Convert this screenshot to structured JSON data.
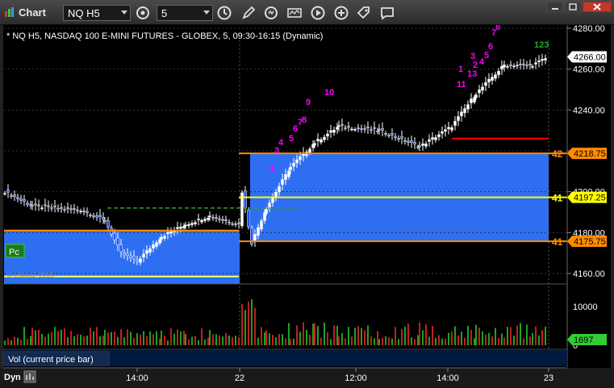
{
  "window": {
    "title": "Chart"
  },
  "toolbar": {
    "symbol": "NQ H5",
    "interval": "5"
  },
  "chart_data": {
    "type": "candlestick",
    "title": "* NQ H5, NASDAQ 100 E-MINI FUTURES - GLOBEX, 5, 09:30-16:15 (Dynamic)",
    "watermark": "© eSignal, 2015",
    "price_axis": {
      "ylim": [
        4155,
        4285
      ],
      "ticks": [
        4160,
        4180,
        4200,
        4220,
        4240,
        4260,
        4280
      ]
    },
    "price_badges": [
      {
        "value": "4266.00",
        "color": "#ffffff"
      },
      {
        "value": "4218.75",
        "color": "#ff8c00"
      },
      {
        "value": "4197.25",
        "color": "#ffff00"
      },
      {
        "value": "4175.75",
        "color": "#ff8c00"
      }
    ],
    "level_labels": [
      {
        "text": "42",
        "value": 4218.75,
        "color": "#ff8c00"
      },
      {
        "text": "41",
        "value": 4197.25,
        "color": "#ffff00"
      },
      {
        "text": "41",
        "value": 4175.75,
        "color": "#ff8c00"
      }
    ],
    "pc_label": "Pc",
    "levels": [
      {
        "value": 4218.75,
        "color": "#ff8c00"
      },
      {
        "value": 4197.25,
        "color": "#ffff00"
      },
      {
        "value": 4175.75,
        "color": "#ff8c00"
      },
      {
        "value": 4181,
        "color": "#ff8c00",
        "session": 1
      },
      {
        "value": 4158.5,
        "color": "#ffff66",
        "session": 1
      },
      {
        "value": 4226,
        "color": "#ff0000",
        "session": 2
      }
    ],
    "td_counts": [
      {
        "text": "1",
        "color": "#ff00ff"
      },
      {
        "text": "3",
        "color": "#ff00ff"
      },
      {
        "text": "4",
        "color": "#ff00ff"
      },
      {
        "text": "5",
        "color": "#ff00ff"
      },
      {
        "text": "6",
        "color": "#ff00ff"
      },
      {
        "text": "7",
        "color": "#ff00ff"
      },
      {
        "text": "8",
        "color": "#ff00ff"
      },
      {
        "text": "9",
        "color": "#ff00ff"
      },
      {
        "text": "10",
        "color": "#ff00ff"
      },
      {
        "text": "1",
        "color": "#ff00ff"
      },
      {
        "text": "11",
        "color": "#ff00ff"
      },
      {
        "text": "13",
        "color": "#ff00ff"
      },
      {
        "text": "2",
        "color": "#ff00ff"
      },
      {
        "text": "3",
        "color": "#ff00ff"
      },
      {
        "text": "4",
        "color": "#ff00ff"
      },
      {
        "text": "5",
        "color": "#ff00ff"
      },
      {
        "text": "6",
        "color": "#ff00ff"
      },
      {
        "text": "7",
        "color": "#ff00ff"
      },
      {
        "text": "8",
        "color": "#ff00ff"
      },
      {
        "text": "123",
        "color": "#22aa22"
      }
    ],
    "volume": {
      "label": "Vol (current price bar)",
      "ticks": [
        0,
        10000
      ],
      "last": "1697"
    },
    "time_axis": [
      "14:00",
      "22",
      "12:00",
      "14:00",
      "23"
    ],
    "footer_label": "Dyn"
  }
}
